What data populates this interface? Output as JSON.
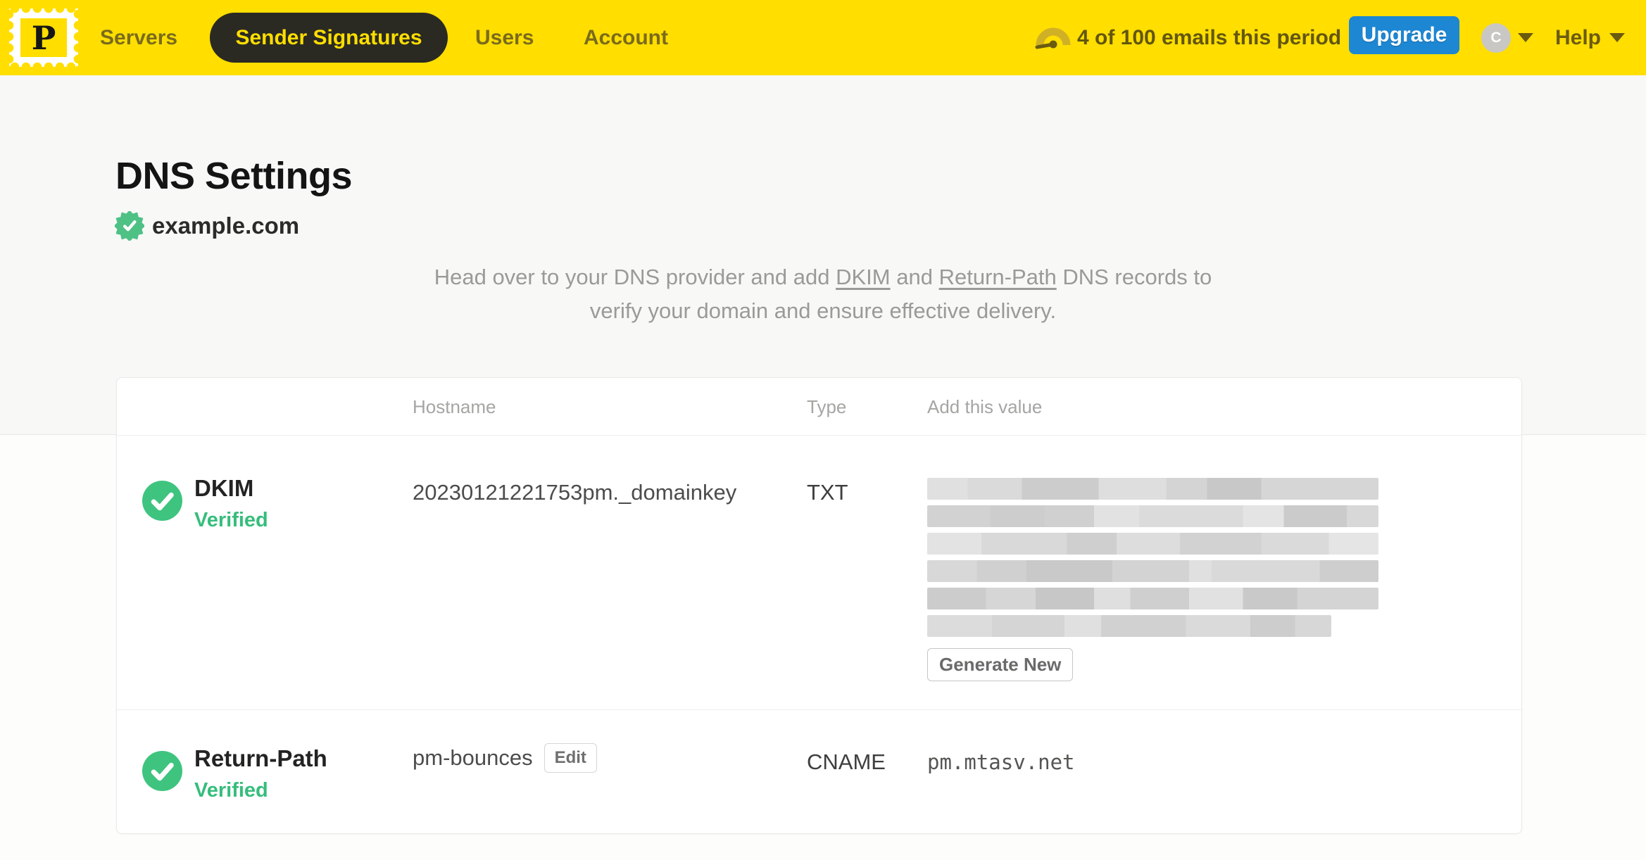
{
  "colors": {
    "brand_yellow": "#ffde00",
    "accent_blue": "#1d87d3",
    "success_green": "#36bd7c"
  },
  "nav": {
    "logo_letter": "P",
    "items": [
      {
        "label": "Servers",
        "active": false
      },
      {
        "label": "Sender Signatures",
        "active": true
      },
      {
        "label": "Users",
        "active": false
      },
      {
        "label": "Account",
        "active": false
      }
    ],
    "usage_text": "4 of 100 emails this period",
    "upgrade_label": "Upgrade",
    "avatar_initial": "C",
    "help_label": "Help"
  },
  "page": {
    "title": "DNS Settings",
    "domain": "example.com",
    "description": {
      "pre": "Head over to your DNS provider and add",
      "link1": "DKIM",
      "mid": "and",
      "link2": "Return-Path",
      "post": "DNS records to",
      "line2": "verify your domain and ensure effective delivery."
    }
  },
  "table": {
    "headers": {
      "hostname": "Hostname",
      "type": "Type",
      "value": "Add this value"
    },
    "rows": [
      {
        "name": "DKIM",
        "status": "Verified",
        "hostname": "20230121221753pm._domainkey",
        "type": "TXT",
        "value_display": "redacted",
        "generate_label": "Generate New"
      },
      {
        "name": "Return-Path",
        "status": "Verified",
        "hostname": "pm-bounces",
        "edit_label": "Edit",
        "type": "CNAME",
        "value": "pm.mtasv.net"
      }
    ]
  }
}
